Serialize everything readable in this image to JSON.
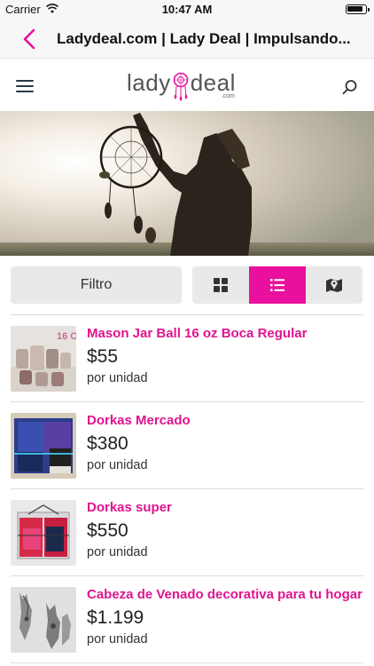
{
  "status_bar": {
    "carrier": "Carrier",
    "time": "10:47 AM"
  },
  "nav": {
    "title": "Ladydeal.com | Lady Deal | Impulsando...",
    "accent": "#e8109c"
  },
  "header": {
    "logo_left": "lady",
    "logo_right": "deal",
    "logo_suffix": ".com"
  },
  "toolbar": {
    "filter_label": "Filtro",
    "active_view": "list"
  },
  "products": [
    {
      "name": "Mason Jar Ball 16 oz Boca Regular",
      "price": "$55",
      "unit": "por unidad",
      "thumb_label": "16 O"
    },
    {
      "name": "Dorkas Mercado",
      "price": "$380",
      "unit": "por unidad"
    },
    {
      "name": "Dorkas super",
      "price": "$550",
      "unit": "por unidad"
    },
    {
      "name": "Cabeza de Venado decorativa para tu hogar",
      "price": "$1.199",
      "unit": "por unidad"
    }
  ],
  "colors": {
    "accent": "#e8109c",
    "product_name": "#e0148f"
  }
}
